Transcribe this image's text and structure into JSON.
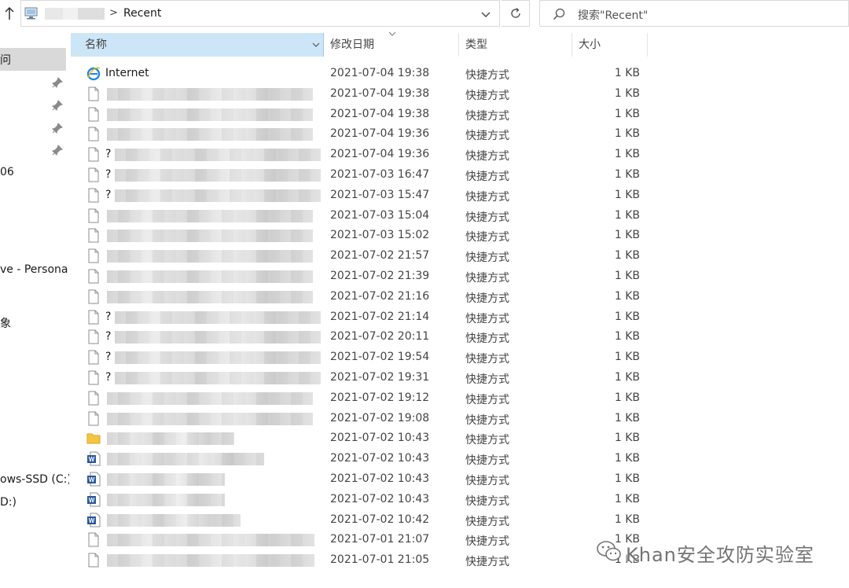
{
  "toolbar": {
    "breadcrumb_separator": ">",
    "current_folder": "Recent",
    "search_placeholder": "搜索\"Recent\""
  },
  "nav": {
    "items": [
      {
        "label": "问"
      },
      {
        "label": "06"
      },
      {
        "label": "ve - Persona"
      },
      {
        "label": "象"
      },
      {
        "label": "ows-SSD (C:)"
      },
      {
        "label": "D:)"
      }
    ]
  },
  "columns": {
    "name": "名称",
    "date": "修改日期",
    "type": "类型",
    "size": "大小"
  },
  "files": [
    {
      "name": "Internet",
      "icon": "ie-icon",
      "date": "2021-07-04 19:38",
      "type": "快捷方式",
      "size": "1 KB"
    },
    {
      "name": "",
      "icon": "file-icon",
      "date": "2021-07-04 19:38",
      "type": "快捷方式",
      "size": "1 KB"
    },
    {
      "name": "",
      "icon": "file-icon",
      "date": "2021-07-04 19:38",
      "type": "快捷方式",
      "size": "1 KB"
    },
    {
      "name": "",
      "icon": "file-icon",
      "date": "2021-07-04 19:36",
      "type": "快捷方式",
      "size": "1 KB"
    },
    {
      "name": "?",
      "icon": "file-icon",
      "date": "2021-07-04 19:36",
      "type": "快捷方式",
      "size": "1 KB"
    },
    {
      "name": "?",
      "icon": "file-icon",
      "date": "2021-07-03 16:47",
      "type": "快捷方式",
      "size": "1 KB"
    },
    {
      "name": "?",
      "icon": "file-icon",
      "date": "2021-07-03 15:47",
      "type": "快捷方式",
      "size": "1 KB"
    },
    {
      "name": "",
      "icon": "file-icon",
      "date": "2021-07-03 15:04",
      "type": "快捷方式",
      "size": "1 KB"
    },
    {
      "name": "",
      "icon": "file-icon",
      "date": "2021-07-03 15:02",
      "type": "快捷方式",
      "size": "1 KB"
    },
    {
      "name": "",
      "icon": "file-icon",
      "date": "2021-07-02 21:57",
      "type": "快捷方式",
      "size": "1 KB"
    },
    {
      "name": "",
      "icon": "file-icon",
      "date": "2021-07-02 21:39",
      "type": "快捷方式",
      "size": "1 KB"
    },
    {
      "name": "",
      "icon": "file-icon",
      "date": "2021-07-02 21:16",
      "type": "快捷方式",
      "size": "1 KB"
    },
    {
      "name": "?",
      "icon": "file-icon",
      "date": "2021-07-02 21:14",
      "type": "快捷方式",
      "size": "1 KB"
    },
    {
      "name": "?",
      "icon": "file-icon",
      "date": "2021-07-02 20:11",
      "type": "快捷方式",
      "size": "1 KB"
    },
    {
      "name": "?",
      "icon": "file-icon",
      "date": "2021-07-02 19:54",
      "type": "快捷方式",
      "size": "1 KB"
    },
    {
      "name": "?",
      "icon": "file-icon",
      "date": "2021-07-02 19:31",
      "type": "快捷方式",
      "size": "1 KB"
    },
    {
      "name": "",
      "icon": "file-icon",
      "date": "2021-07-02 19:12",
      "type": "快捷方式",
      "size": "1 KB"
    },
    {
      "name": "",
      "icon": "file-icon",
      "date": "2021-07-02 19:08",
      "type": "快捷方式",
      "size": "1 KB"
    },
    {
      "name": "",
      "icon": "folder-icon",
      "date": "2021-07-02 10:43",
      "type": "快捷方式",
      "size": "1 KB"
    },
    {
      "name": "",
      "icon": "word-icon",
      "date": "2021-07-02 10:43",
      "type": "快捷方式",
      "size": "1 KB"
    },
    {
      "name": "",
      "icon": "word-icon",
      "date": "2021-07-02 10:43",
      "type": "快捷方式",
      "size": "1 KB"
    },
    {
      "name": "",
      "icon": "word-icon",
      "date": "2021-07-02 10:43",
      "type": "快捷方式",
      "size": "1 KB"
    },
    {
      "name": "",
      "icon": "word-icon",
      "date": "2021-07-02 10:42",
      "type": "快捷方式",
      "size": "1 KB"
    },
    {
      "name": "",
      "icon": "file-icon",
      "date": "2021-07-01 21:07",
      "type": "快捷方式",
      "size": "1 KB"
    },
    {
      "name": "",
      "icon": "file-icon",
      "date": "2021-07-01 21:05",
      "type": "快捷方式",
      "size": "1 KB"
    }
  ],
  "watermark": {
    "text": "Khan安全攻防实验室",
    "icon": "wechat-icon"
  },
  "colors": {
    "selected_header": "#cde6f7",
    "nav_selected": "#d9d9d9",
    "word_blue": "#2b579a",
    "ie_blue": "#1e88e5",
    "folder_yellow": "#f4c542"
  }
}
